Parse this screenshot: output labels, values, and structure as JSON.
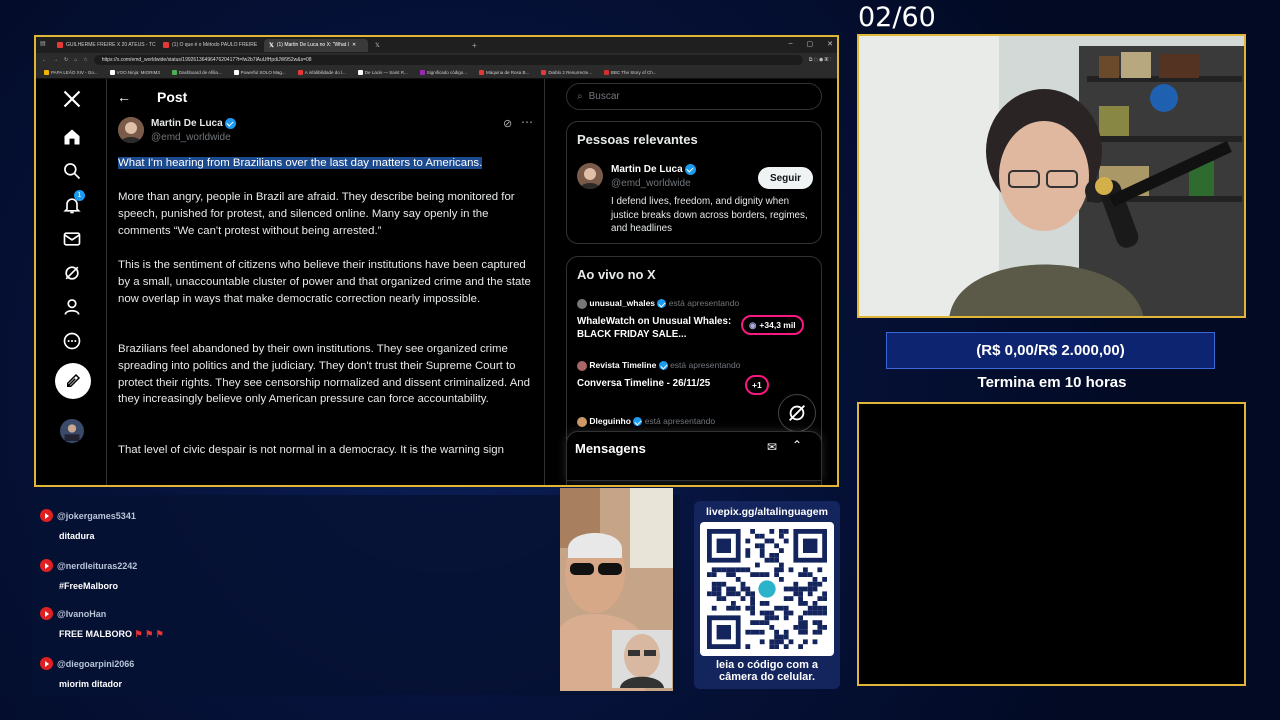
{
  "counter": "02/60",
  "browser": {
    "tabs": [
      {
        "label": "GUILHERME FREIRE X 20 ATEUS - TC",
        "color": "#e53935",
        "active": false
      },
      {
        "label": "(1) O que é o Método PAULO FREIRE",
        "color": "#e53935",
        "active": false
      },
      {
        "label": "(1) Martin De Luca no X: \"What I",
        "color": "#ffffff",
        "active": true
      },
      {
        "label": "X",
        "color": "#ffffff",
        "active": false
      }
    ],
    "url": "https://x.com/emd_worldwide/status/1992613649647620417?t=fw2b7lAuUfHpdiJW952w&s=08",
    "bookmarks": [
      "PAPA LEÃO XIV - Go...",
      "VOO.Ninja: MIORIM3",
      "Dashboard de Afilia...",
      "Powerful SOLO Mag...",
      "A infalibilidade do l...",
      "De Lacis — Saint R...",
      "Significado código...",
      "Máquina de Rosa B...",
      "Diablo 2 Resurrecte...",
      "BBC The Story of Ch..."
    ],
    "bookmark_colors": [
      "#f4b400",
      "#ffffff",
      "#4caf50",
      "#ffffff",
      "#e53935",
      "#ffffff",
      "#9c27b0",
      "#e53935",
      "#e53935",
      "#d32f2f"
    ]
  },
  "x": {
    "nav": {
      "notification_count": "1"
    },
    "header": {
      "title": "Post"
    },
    "post": {
      "author_name": "Martin De Luca",
      "author_handle": "@emd_worldwide",
      "p1": "What I'm hearing from Brazilians over the last day matters to Americans.",
      "p2": "More than angry, people in Brazil are afraid. They describe being monitored for speech, punished for protest, and silenced online. Many say openly in the comments “We can't protest without being arrested.”",
      "p3": "This is the sentiment of citizens who believe their institutions have been captured by a small, unaccountable cluster of power and that organized crime and the state now overlap in ways that make democratic correction nearly impossible.",
      "p4": "Brazilians feel abandoned by their own institutions. They see organized crime spreading into politics and the judiciary. They don't trust their Supreme Court to protect their rights. They see censorship normalized and dissent criminalized. And they increasingly believe only American pressure can force accountability.",
      "p5": "That level of civic despair is not normal in a democracy. It is the warning sign"
    },
    "search": {
      "placeholder": "Buscar"
    },
    "relevant": {
      "heading": "Pessoas relevantes",
      "name": "Martin De Luca",
      "handle": "@emd_worldwide",
      "follow_label": "Seguir",
      "bio": "I defend lives, freedom, and dignity when justice breaks down across borders, regimes, and headlines"
    },
    "live": {
      "heading": "Ao vivo no X",
      "items": [
        {
          "host": "unusual_whales",
          "status": "está apresentando",
          "title": "WhaleWatch on Unusual Whales: BLACK FRIDAY SALE...",
          "count": "+34,3 mil"
        },
        {
          "host": "Revista Timeline",
          "status": "está apresentando",
          "title": "Conversa Timeline - 26/11/25",
          "count": "+1"
        },
        {
          "host": "Dleguinho",
          "status": "está apresentando",
          "title": "",
          "count": ""
        }
      ]
    },
    "messages": {
      "label": "Mensagens"
    }
  },
  "overlay": {
    "progress": "(R$ 0,00/R$ 2.000,00)",
    "ends": "Termina em 10 horas",
    "qr_url": "livepix.gg/altalinguagem",
    "qr_caption": "leia o código com a câmera do celular."
  },
  "chat": [
    {
      "user": "@jokergames5341",
      "text": "ditadura"
    },
    {
      "user": "@nerdleituras2242",
      "text": "#FreeMalboro"
    },
    {
      "user": "@IvanoHan",
      "text": "FREE MALBORO"
    },
    {
      "user": "@diegoarpini2066",
      "text": "miorim ditador"
    }
  ],
  "colors": {
    "accent_gold": "#e1b637",
    "x_blue": "#1d9bf0",
    "live_pink": "#f91880"
  }
}
